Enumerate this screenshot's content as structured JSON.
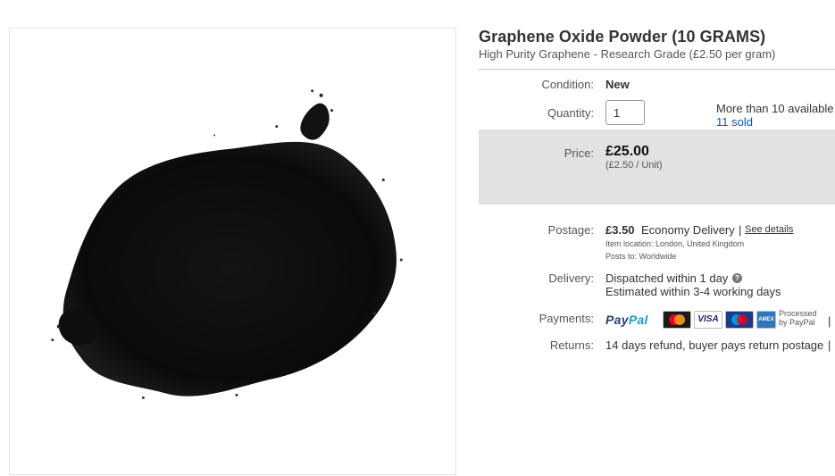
{
  "product": {
    "title": "Graphene Oxide Powder (10 GRAMS)",
    "subtitle": "High Purity Graphene - Research Grade (£2.50 per gram)"
  },
  "condition": {
    "label": "Condition:",
    "value": "New"
  },
  "quantity": {
    "label": "Quantity:",
    "value": "1",
    "available": "More than 10 available",
    "sold": "11 sold"
  },
  "price": {
    "label": "Price:",
    "value": "£25.00",
    "unit": "(£2.50 / Unit)"
  },
  "postage": {
    "label": "Postage:",
    "amount": "£3.50",
    "method": "Economy Delivery",
    "separator": "|",
    "see_details": "See details",
    "item_location": "Item location:  London, United Kingdom",
    "posts_to": "Posts to:  Worldwide"
  },
  "delivery": {
    "label": "Delivery:",
    "dispatched": "Dispatched within 1 day",
    "estimated": "Estimated within 3-4 working days",
    "help_icon": "question-circle-icon"
  },
  "payments": {
    "label": "Payments:",
    "paypal_a": "Pay",
    "paypal_b": "Pal",
    "cards": [
      {
        "name": "MasterCard",
        "icon": "mastercard-icon"
      },
      {
        "name": "VISA",
        "icon": "visa-icon"
      },
      {
        "name": "Maestro",
        "icon": "maestro-icon"
      },
      {
        "name": "AMEX",
        "icon": "amex-icon"
      }
    ],
    "processed_1": "Processed",
    "processed_2": "by PayPal",
    "separator": "|"
  },
  "returns": {
    "label": "Returns:",
    "value": "14 days refund, buyer pays return postage",
    "separator": "|"
  },
  "colors": {
    "link": "#0654ba",
    "price_bg": "#e2e2e2",
    "paypal_dark": "#253b80",
    "paypal_light": "#179bd7"
  }
}
